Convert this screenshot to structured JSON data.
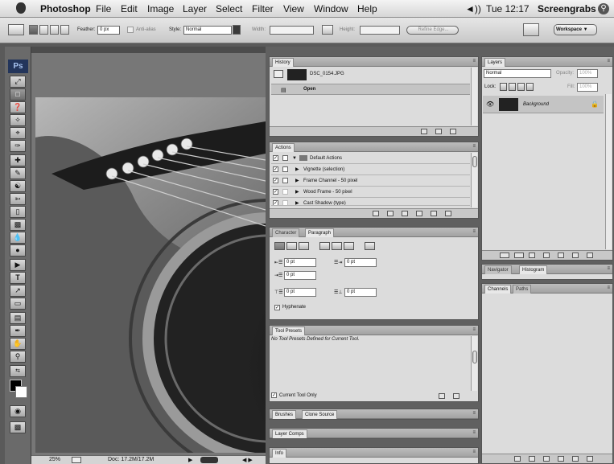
{
  "menubar": {
    "apple_icon": "apple-logo-icon",
    "app_name": "Photoshop",
    "menus": [
      "File",
      "Edit",
      "Image",
      "Layer",
      "Select",
      "Filter",
      "View",
      "Window",
      "Help"
    ],
    "volume_icon": "speaker-icon",
    "clock": "Tue 12:17",
    "user": "Screengrabs",
    "spotlight_icon": "spotlight-search-icon"
  },
  "options_bar": {
    "feather_label": "Feather:",
    "feather_value": "0 px",
    "antialias_label": "Anti-alias",
    "style_label": "Style:",
    "style_value": "Normal",
    "width_label": "Width:",
    "height_label": "Height:",
    "refine_edge_label": "Refine Edge...",
    "workspace_label": "Workspace ▼"
  },
  "toolbox": {
    "logo": "Ps"
  },
  "status_bar": {
    "zoom": "25%",
    "doc_info": "Doc: 17.2M/17.2M"
  },
  "history_panel": {
    "tab": "History",
    "snapshot_name": "DSC_0154.JPG",
    "steps": [
      "Open"
    ]
  },
  "actions_panel": {
    "tab": "Actions",
    "set_name": "Default Actions",
    "actions": [
      "Vignette (selection)",
      "Frame Channel - 50 pixel",
      "Wood Frame - 50 pixel",
      "Cast Shadow (type)"
    ]
  },
  "character_panel": {
    "tabs": [
      "Character",
      "Paragraph"
    ],
    "active_tab": "Paragraph",
    "indent_left": "0 pt",
    "indent_right": "0 pt",
    "indent_first": "0 pt",
    "space_before": "0 pt",
    "space_after": "0 pt",
    "hyphenate_label": "Hyphenate"
  },
  "tool_presets_panel": {
    "tab": "Tool Presets",
    "empty_message": "No Tool Presets Defined for Current Tool.",
    "current_tool_only_label": "Current Tool Only"
  },
  "brushes_panel": {
    "tabs": [
      "Brushes",
      "Clone Source"
    ]
  },
  "layer_comps_panel": {
    "tab": "Layer Comps"
  },
  "info_panel": {
    "tab": "Info"
  },
  "layers_panel": {
    "tab": "Layers",
    "blend_mode": "Normal",
    "opacity_label": "Opacity:",
    "opacity_value": "100%",
    "lock_label": "Lock:",
    "fill_label": "Fill:",
    "fill_value": "100%",
    "layer_name": "Background"
  },
  "navigator_panel": {
    "tabs": [
      "Navigator",
      "Histogram"
    ]
  },
  "channels_panel": {
    "tabs": [
      "Channels",
      "Paths"
    ]
  },
  "colors": {
    "menubar": "#e8e8e8",
    "panel_bg": "#dcdcdc",
    "dock_bg": "#606060",
    "ps_logo": "#23355b"
  }
}
